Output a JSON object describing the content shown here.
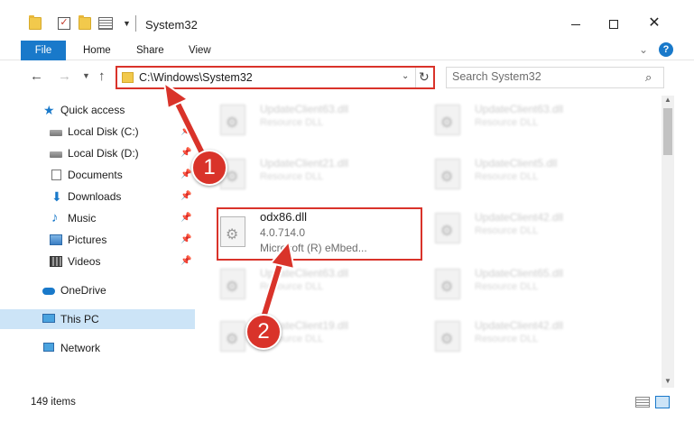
{
  "window": {
    "title": "System32",
    "min_glyph": "",
    "close_glyph": "✕"
  },
  "ribbon": {
    "tabs": [
      "File",
      "Home",
      "Share",
      "View"
    ],
    "help_glyph": "?"
  },
  "address": {
    "path": "C:\\Windows\\System32"
  },
  "search": {
    "placeholder": "Search System32"
  },
  "sidebar": {
    "items": [
      {
        "label": "Quick access",
        "icon": "star-icon"
      },
      {
        "label": "Local Disk (C:)",
        "icon": "drive-icon"
      },
      {
        "label": "Local Disk (D:)",
        "icon": "drive-icon"
      },
      {
        "label": "Documents",
        "icon": "documents-icon"
      },
      {
        "label": "Downloads",
        "icon": "download-icon"
      },
      {
        "label": "Music",
        "icon": "music-icon"
      },
      {
        "label": "Pictures",
        "icon": "pictures-icon"
      },
      {
        "label": "Videos",
        "icon": "videos-icon"
      },
      {
        "label": "OneDrive",
        "icon": "cloud-icon"
      },
      {
        "label": "This PC",
        "icon": "computer-icon"
      },
      {
        "label": "Network",
        "icon": "network-icon"
      }
    ]
  },
  "files": [
    {
      "name": "UpdateClient63.dll",
      "desc": "Resource DLL"
    },
    {
      "name": "UpdateClient63.dll",
      "desc": "Resource DLL"
    },
    {
      "name": "UpdateClient21.dll",
      "desc": "Resource DLL"
    },
    {
      "name": "UpdateClient5.dll",
      "desc": "Resource DLL"
    },
    {
      "name": "odx86.dll",
      "version": "4.0.714.0",
      "desc": "Microsoft (R) eMbed..."
    },
    {
      "name": "UpdateClient42.dll",
      "desc": "Resource DLL"
    },
    {
      "name": "UpdateClient63.dll",
      "desc": "Resource DLL"
    },
    {
      "name": "UpdateClient65.dll",
      "desc": "Resource DLL"
    },
    {
      "name": "UpdateClient19.dll",
      "desc": "Resource DLL"
    },
    {
      "name": "UpdateClient42.dll",
      "desc": "Resource DLL"
    }
  ],
  "status": {
    "item_count": "149 items"
  },
  "annotations": {
    "step1": "1",
    "step2": "2",
    "color": "#d9332a"
  },
  "colors": {
    "accent": "#1979ca",
    "selected": "#cce4f7"
  }
}
